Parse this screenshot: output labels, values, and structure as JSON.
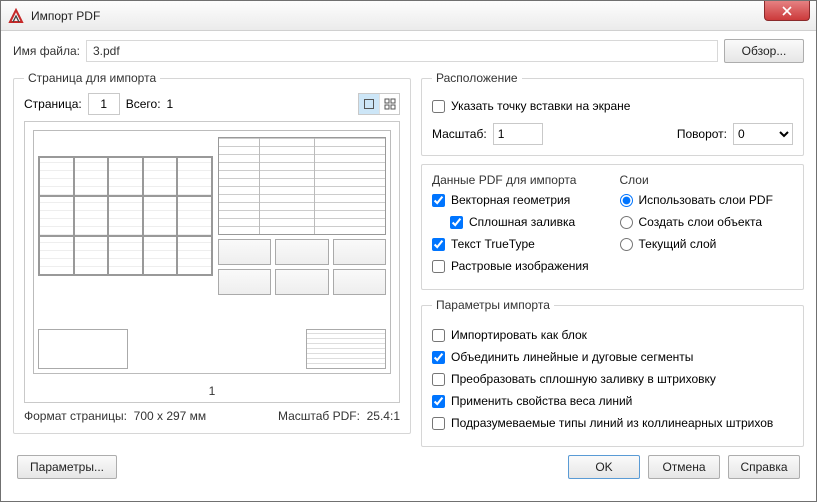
{
  "window": {
    "title": "Импорт PDF"
  },
  "file": {
    "label": "Имя файла:",
    "value": "3.pdf",
    "browse": "Обзор..."
  },
  "pagegroup": {
    "legend": "Страница для импорта",
    "page_label": "Страница:",
    "page_value": "1",
    "total_label": "Всего:",
    "total_value": "1",
    "page_number": "1",
    "format_label": "Формат страницы:",
    "format_value": "700 x  297 мм",
    "scale_label": "Масштаб PDF:",
    "scale_value": "25.4:1"
  },
  "location": {
    "legend": "Расположение",
    "specify_point": "Указать точку вставки на экране",
    "scale_label": "Масштаб:",
    "scale_value": "1",
    "rotation_label": "Поворот:",
    "rotation_value": "0"
  },
  "pdfdata": {
    "legend": "Данные PDF для импорта",
    "vector": "Векторная геометрия",
    "solid_fill": "Сплошная заливка",
    "truetype": "Текст TrueType",
    "raster": "Растровые изображения"
  },
  "layers": {
    "legend": "Слои",
    "use_pdf": "Использовать слои PDF",
    "create_obj": "Создать слои объекта",
    "current": "Текущий слой"
  },
  "import_params": {
    "legend": "Параметры импорта",
    "as_block": "Импортировать как блок",
    "join": "Объединить линейные и дуговые сегменты",
    "convert_fill": "Преобразовать сплошную заливку в штриховку",
    "apply_lw": "Применить свойства веса линий",
    "infer_lt": "Подразумеваемые типы линий из коллинеарных штрихов"
  },
  "footer": {
    "options": "Параметры...",
    "ok": "OK",
    "cancel": "Отмена",
    "help": "Справка"
  }
}
